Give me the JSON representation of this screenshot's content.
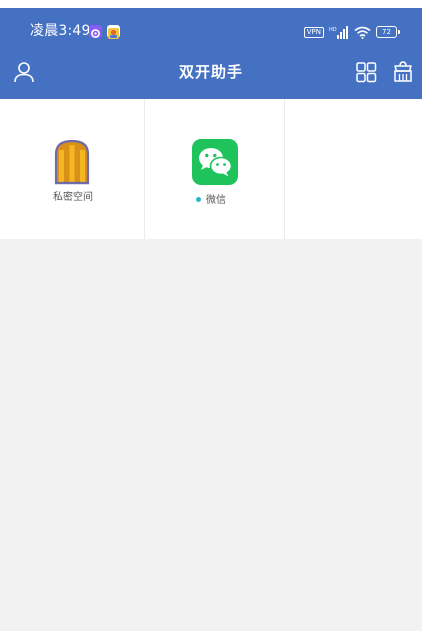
{
  "status_bar": {
    "time": "凌晨3:49",
    "vpn": "VPN",
    "signal": "HD",
    "battery": "72"
  },
  "app_bar": {
    "title": "双开助手",
    "user_icon": "user-icon",
    "grid_icon": "grid-view-icon",
    "store_icon": "store-icon"
  },
  "apps": [
    {
      "label": "私密空间",
      "icon": "private-space-icon",
      "status_dot": false
    },
    {
      "label": "微信",
      "icon": "wechat-icon",
      "status_dot": true
    }
  ],
  "colors": {
    "header": "#4571c2",
    "wechat": "#1ec45b",
    "private_space": "#f5a623",
    "status_dot": "#2bb7c9",
    "background": "#f2f2f2"
  }
}
